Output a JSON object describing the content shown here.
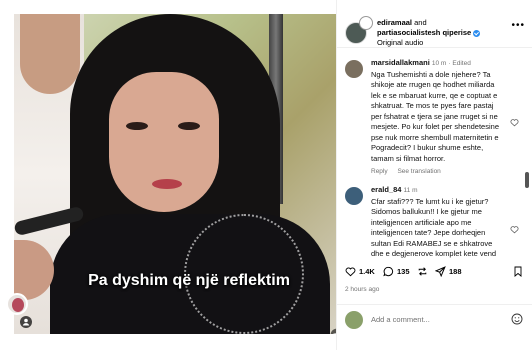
{
  "video": {
    "caption": "Pa dyshim që një reflektim"
  },
  "header": {
    "user1": "ediramaal",
    "and_text": "and",
    "user2": "partiasocialistesh qiperise",
    "user2_full": "partiasocialistesh qiperise",
    "audio": "Original audio",
    "more_icon": "more-dots-icon"
  },
  "comments": [
    {
      "user": "marsidallakmani",
      "time": "10 m",
      "edited": "· Edited",
      "text": "Nga Tushemishti a dole njehere? Ta shikoje ate rrugen qe hodhet miliarda lek e se mbaruat kurre, qe e coptuat e shkatruat. Te mos te pyes fare pastaj per fshatrat e tjera se jane rruget si ne mesjete. Po kur folet per shendetesine pse nuk morre shembull maternitetin e Pogradecit? I bukur shume eshte, tamam si filmat horror.",
      "reply": "Reply",
      "translation": "See translation",
      "avatar_color": "#7a6f5f"
    },
    {
      "user": "erald_84",
      "time": "11 m",
      "edited": "",
      "text": "Cfar stafi??? Te lumt ku i ke gjetur? Sidomos ballukun!! I ke gjetur me inteligjencen artificiale apo me inteligjencen tate? Jepe dorheqjen sultan Edi RAMABEJ se e shkatrove dhe e degjenerove komplet kete vend dhe keto popujll!! Se pjesën",
      "reply": "",
      "translation": "",
      "avatar_color": "#3d5f7a"
    }
  ],
  "actions": {
    "likes": "1.4K",
    "comments": "135",
    "shares": "188"
  },
  "time_ago": "2 hours ago",
  "add_comment": {
    "placeholder": "Add a comment..."
  }
}
